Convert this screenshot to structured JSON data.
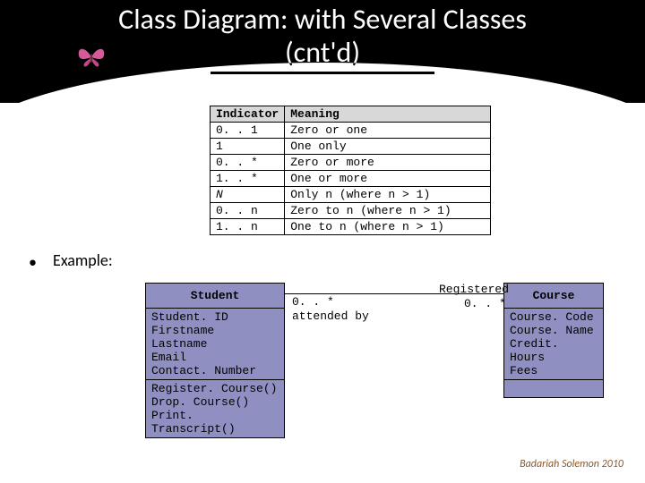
{
  "title_line1": "Class Diagram: with Several Classes",
  "title_line2": "(cnt'd)",
  "table": {
    "headers": [
      "Indicator",
      "Meaning"
    ],
    "rows": [
      [
        "0. . 1",
        "Zero or one"
      ],
      [
        "1",
        "One only"
      ],
      [
        "0. . *",
        "Zero or more"
      ],
      [
        "1. . *",
        "One or more"
      ],
      [
        "N",
        "Only n (where n > 1)"
      ],
      [
        "0. . n",
        "Zero to n (where n > 1)"
      ],
      [
        "1. . n",
        "One to n (where n > 1)"
      ]
    ]
  },
  "bullet_label": "Example:",
  "student": {
    "name": "Student",
    "attrs": [
      "Student. ID",
      "Firstname",
      "Lastname",
      "Email",
      "Contact. Number"
    ],
    "ops": [
      "Register. Course()",
      "Drop. Course()",
      "Print. Transcript()"
    ]
  },
  "course": {
    "name": "Course",
    "attrs": [
      "Course. Code",
      "Course. Name",
      "Credit. Hours",
      "Fees"
    ],
    "ops": []
  },
  "assoc": {
    "left_mult": "0. . *",
    "right_name": "Registered",
    "right_mult": "0. . *",
    "role": "attended by"
  },
  "footer": "Badariah Solemon 2010"
}
